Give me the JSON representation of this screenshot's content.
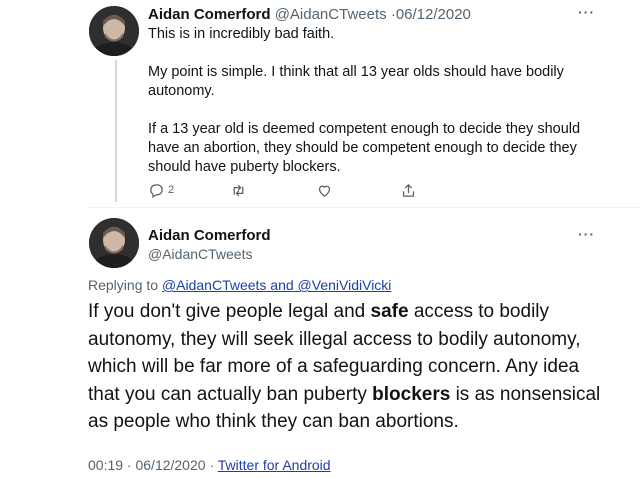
{
  "tweet1": {
    "author_name": "Aidan Comerford",
    "author_handle": "@AidanCTweets",
    "separator": "·",
    "date": "06/12/2020",
    "more_label": "···",
    "paragraphs": [
      "This is in incredibly bad faith.",
      "My point is simple. I think that all 13 year olds should have bodily autonomy.",
      "If a 13 year old is deemed competent enough to decide they should have an abortion, they should be competent enough to decide they should have puberty blockers."
    ],
    "actions": {
      "reply_count": "2",
      "reply_icon": "reply-icon",
      "retweet_icon": "retweet-icon",
      "like_icon": "like-icon",
      "share_icon": "share-icon"
    }
  },
  "tweet2": {
    "author_name": "Aidan Comerford",
    "author_handle": "@AidanCTweets",
    "more_label": "···",
    "replying_prefix": "Replying to",
    "replying_to": "@AidanCTweets and @VeniVidiVicki",
    "body_parts": [
      "If you don't give people legal and ",
      "safe",
      " access to bodily autonomy, they will seek illegal access to bodily autonomy, which will be far more of a safeguarding concern. Any idea that you can actually ban puberty ",
      "blockers",
      " is as nonsensical as people who think they can ban abortions."
    ],
    "timestamp": "00:19 · 06/12/2020",
    "footer_separator": "·",
    "source": "Twitter for Android"
  },
  "colors": {
    "text": "#0f1419",
    "muted": "#536471",
    "link": "#1d3fa8",
    "thread_line": "#cfd9de"
  }
}
